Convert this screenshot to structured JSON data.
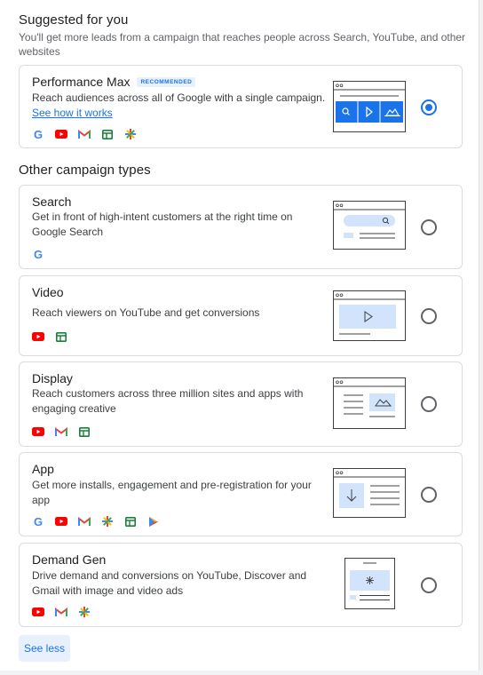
{
  "suggested": {
    "title": "Suggested for you",
    "subtitle": "You'll get more leads from a campaign that reaches people across Search, YouTube, and other websites"
  },
  "other": {
    "title": "Other campaign types"
  },
  "cards": [
    {
      "name": "Performance Max",
      "badge": "RECOMMENDED",
      "desc": "Reach audiences across all of Google with a single campaign.",
      "link": "See how it works",
      "selected": true,
      "icons": [
        "google-icon",
        "youtube-icon",
        "gmail-icon",
        "sheets-icon",
        "discover-icon"
      ]
    },
    {
      "name": "Search",
      "desc": "Get in front of high-intent customers at the right time on Google Search",
      "selected": false,
      "icons": [
        "google-icon"
      ]
    },
    {
      "name": "Video",
      "desc": "Reach viewers on YouTube and get conversions",
      "selected": false,
      "icons": [
        "youtube-icon",
        "sheets-icon"
      ]
    },
    {
      "name": "Display",
      "desc": "Reach customers across three million sites and apps with engaging creative",
      "selected": false,
      "icons": [
        "youtube-icon",
        "gmail-icon",
        "sheets-icon"
      ]
    },
    {
      "name": "App",
      "desc": "Get more installs, engagement and pre-registration for your app",
      "selected": false,
      "icons": [
        "google-icon",
        "youtube-icon",
        "gmail-icon",
        "discover-icon",
        "sheets-icon",
        "play-icon"
      ]
    },
    {
      "name": "Demand Gen",
      "desc": "Drive demand and conversions on YouTube, Discover and Gmail with image and video ads",
      "selected": false,
      "icons": [
        "youtube-icon",
        "gmail-icon",
        "discover-icon"
      ]
    }
  ],
  "footer": {
    "see_less": "See less"
  },
  "colors": {
    "accent": "#1a73e8",
    "illus_fill": "#d2e3fc",
    "border": "#dadce0"
  }
}
